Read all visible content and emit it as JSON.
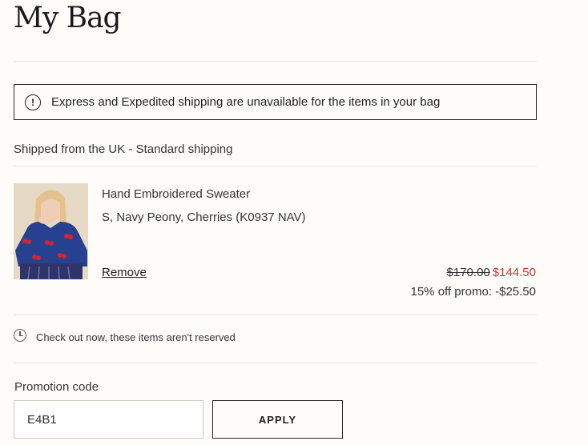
{
  "header": {
    "title": "My Bag"
  },
  "alert": {
    "icon": "exclamation-circle-icon",
    "text": "Express and Expedited shipping are unavailable for the items in your bag"
  },
  "shipping": {
    "label": "Shipped from the UK - Standard shipping"
  },
  "item": {
    "name": "Hand Embroidered Sweater",
    "variant": "S, Navy Peony, Cherries (K0937 NAV)",
    "remove_label": "Remove",
    "original_price": "$170.00",
    "sale_price": "$144.50",
    "promo_text": "15% off promo: -$25.50"
  },
  "reservation": {
    "icon": "clock-icon",
    "text": "Check out now, these items aren't reserved"
  },
  "promotion": {
    "label": "Promotion code",
    "input_value": "E4B1",
    "apply_label": "APPLY"
  },
  "colors": {
    "background": "#fdfcf9",
    "sale_red": "#c8342c",
    "text": "#222222"
  }
}
